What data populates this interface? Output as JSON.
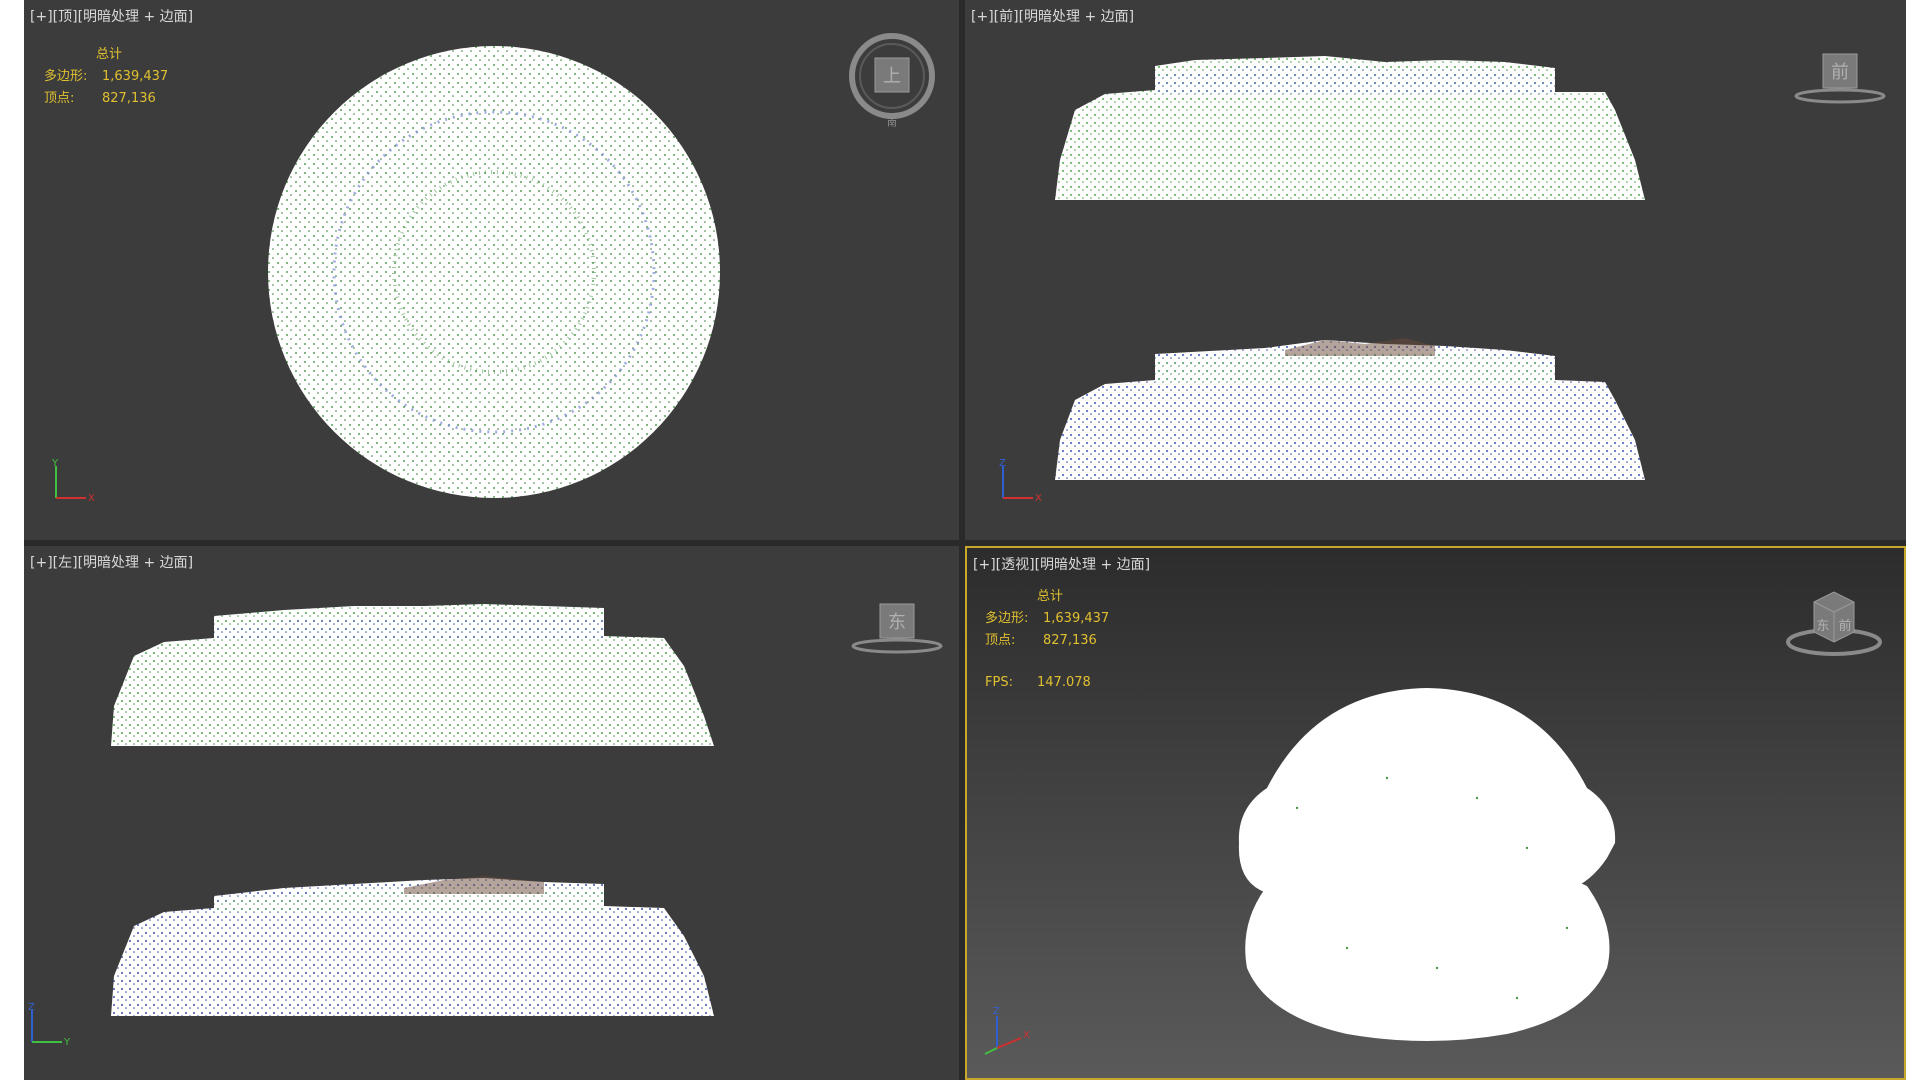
{
  "viewports": {
    "top": {
      "label_plus": "[+]",
      "label_view": "[顶]",
      "label_mode": "[明暗处理 + 边面]",
      "viewcube_face": "上",
      "viewcube_south": "南"
    },
    "front": {
      "label_plus": "[+]",
      "label_view": "[前]",
      "label_mode": "[明暗处理 + 边面]",
      "viewcube_face": "前"
    },
    "left": {
      "label_plus": "[+]",
      "label_view": "[左]",
      "label_mode": "[明暗处理 + 边面]",
      "viewcube_face": "东"
    },
    "perspective": {
      "label_plus": "[+]",
      "label_view": "[透视]",
      "label_mode": "[明暗处理 + 边面]",
      "viewcube_face_a": "东",
      "viewcube_face_b": "前"
    }
  },
  "stats": {
    "title": "总计",
    "polygons_label": "多边形:",
    "polygons_value": "1,639,437",
    "vertices_label": "顶点:",
    "vertices_value": "827,136",
    "fps_label": "FPS:",
    "fps_value": "147.078"
  },
  "axes": {
    "x": "X",
    "y": "Y",
    "z": "Z"
  },
  "colors": {
    "viewport_bg": "#3c3c3c",
    "active_border": "#c8a82a",
    "stats_text": "#e0c030",
    "mesh_white": "#ffffff",
    "mesh_green": "#4a9a4a",
    "mesh_blue": "#3a5ab0",
    "mesh_brown": "#6a4a3a"
  }
}
